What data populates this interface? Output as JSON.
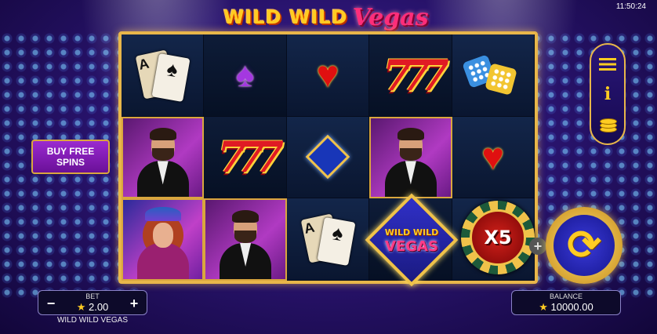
{
  "status": {
    "time": "11:50:24"
  },
  "logo": {
    "part1": "WILD WILD",
    "part2": "Vegas"
  },
  "buy_free_spins": {
    "line1": "BUY FREE",
    "line2": "SPINS"
  },
  "bet": {
    "label": "BET",
    "value": "2.00",
    "minus": "−",
    "plus": "+"
  },
  "game_name": "WILD WILD VEGAS",
  "balance": {
    "label": "BALANCE",
    "value": "10000.00"
  },
  "star": "★",
  "reels": [
    [
      "cards",
      "person-man",
      "person-woman"
    ],
    [
      "spade",
      "sevens",
      "person-man"
    ],
    [
      "heart",
      "diamond",
      "cards"
    ],
    [
      "sevens",
      "person-man",
      "wild"
    ],
    [
      "dice",
      "heart",
      "multiplier"
    ]
  ],
  "symbols": {
    "spade": "♠",
    "heart": "♥",
    "sevens": "777",
    "card_letter": "A",
    "card_suit": "♠"
  },
  "wild": {
    "line1": "WILD WILD",
    "line2": "VEGAS"
  },
  "multiplier": {
    "text": "X5"
  },
  "plus_small": "+",
  "spin_icon": "⟳",
  "menu": {
    "info": "i"
  }
}
